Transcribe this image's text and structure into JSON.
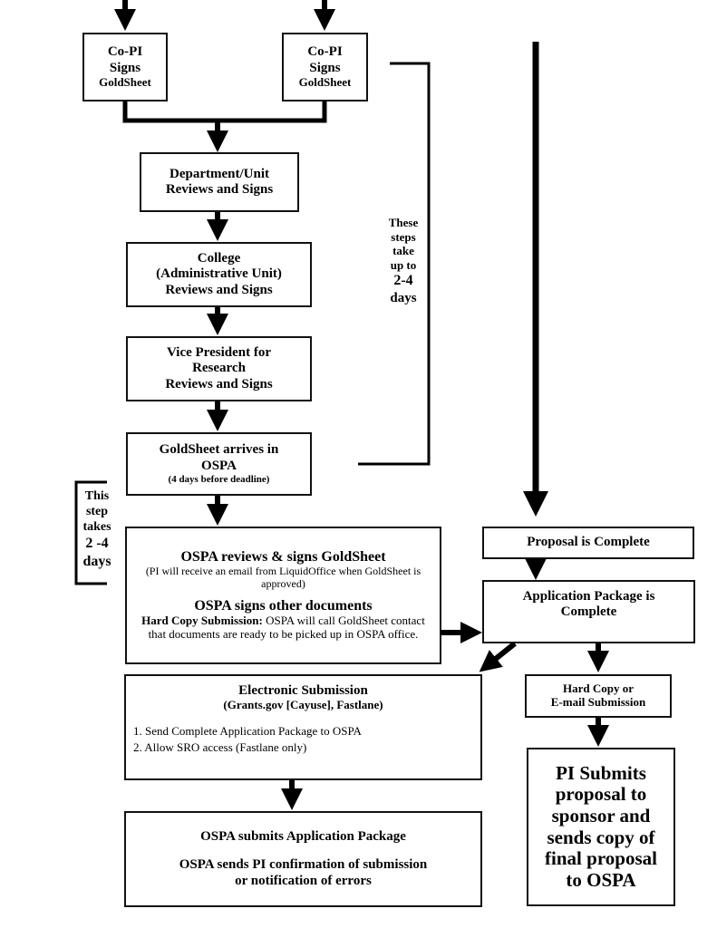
{
  "nodes": {
    "copi_left": {
      "line1": "Co-PI",
      "line2": "Signs",
      "line3": "GoldSheet"
    },
    "copi_right": {
      "line1": "Co-PI",
      "line2": "Signs",
      "line3": "GoldSheet"
    },
    "department": {
      "line1": "Department/Unit",
      "line2": "Reviews and Signs"
    },
    "college": {
      "line1": "College",
      "line2": "(Administrative Unit)",
      "line3": "Reviews and Signs"
    },
    "vpr": {
      "line1": "Vice President for",
      "line2": "Research",
      "line3": "Reviews and Signs"
    },
    "goldsheet_arrives": {
      "line1": "GoldSheet arrives in",
      "line2": "OSPA",
      "line3": "(4 days before deadline)"
    },
    "ospa_reviews": {
      "title": "OSPA reviews & signs GoldSheet",
      "subtitle": "(PI will receive an email from LiquidOffice when GoldSheet is approved)",
      "title2": "OSPA signs other documents",
      "hard_copy_label": "Hard Copy Submission:",
      "hard_copy_text": " OSPA will call GoldSheet contact that documents are ready to be picked up in OSPA office."
    },
    "proposal_complete": {
      "label": "Proposal is Complete"
    },
    "app_package_complete": {
      "line1": "Application Package is",
      "line2": "Complete"
    },
    "electronic_submission": {
      "title": "Electronic Submission",
      "subtitle": "(Grants.gov [Cayuse], Fastlane)",
      "steps": [
        "1. Send Complete Application Package to OSPA",
        "2. Allow SRO access (Fastlane only)"
      ]
    },
    "hard_copy_email": {
      "line1": "Hard Copy or",
      "line2": "E-mail Submission"
    },
    "ospa_submits": {
      "line1": "OSPA submits Application Package",
      "line2": "OSPA sends PI confirmation of submission",
      "line3": "or notification of errors"
    },
    "pi_submits": {
      "lines": [
        "PI Submits",
        "proposal to",
        "sponsor and",
        "sends copy of",
        "final proposal",
        "to OSPA"
      ]
    }
  },
  "notes": {
    "steps_duration": {
      "lines": [
        "These",
        "steps",
        "take",
        "up to",
        "2-4",
        "days"
      ]
    },
    "step_duration": {
      "lines": [
        "This",
        "step",
        "takes",
        "2 -4",
        "days"
      ]
    }
  }
}
